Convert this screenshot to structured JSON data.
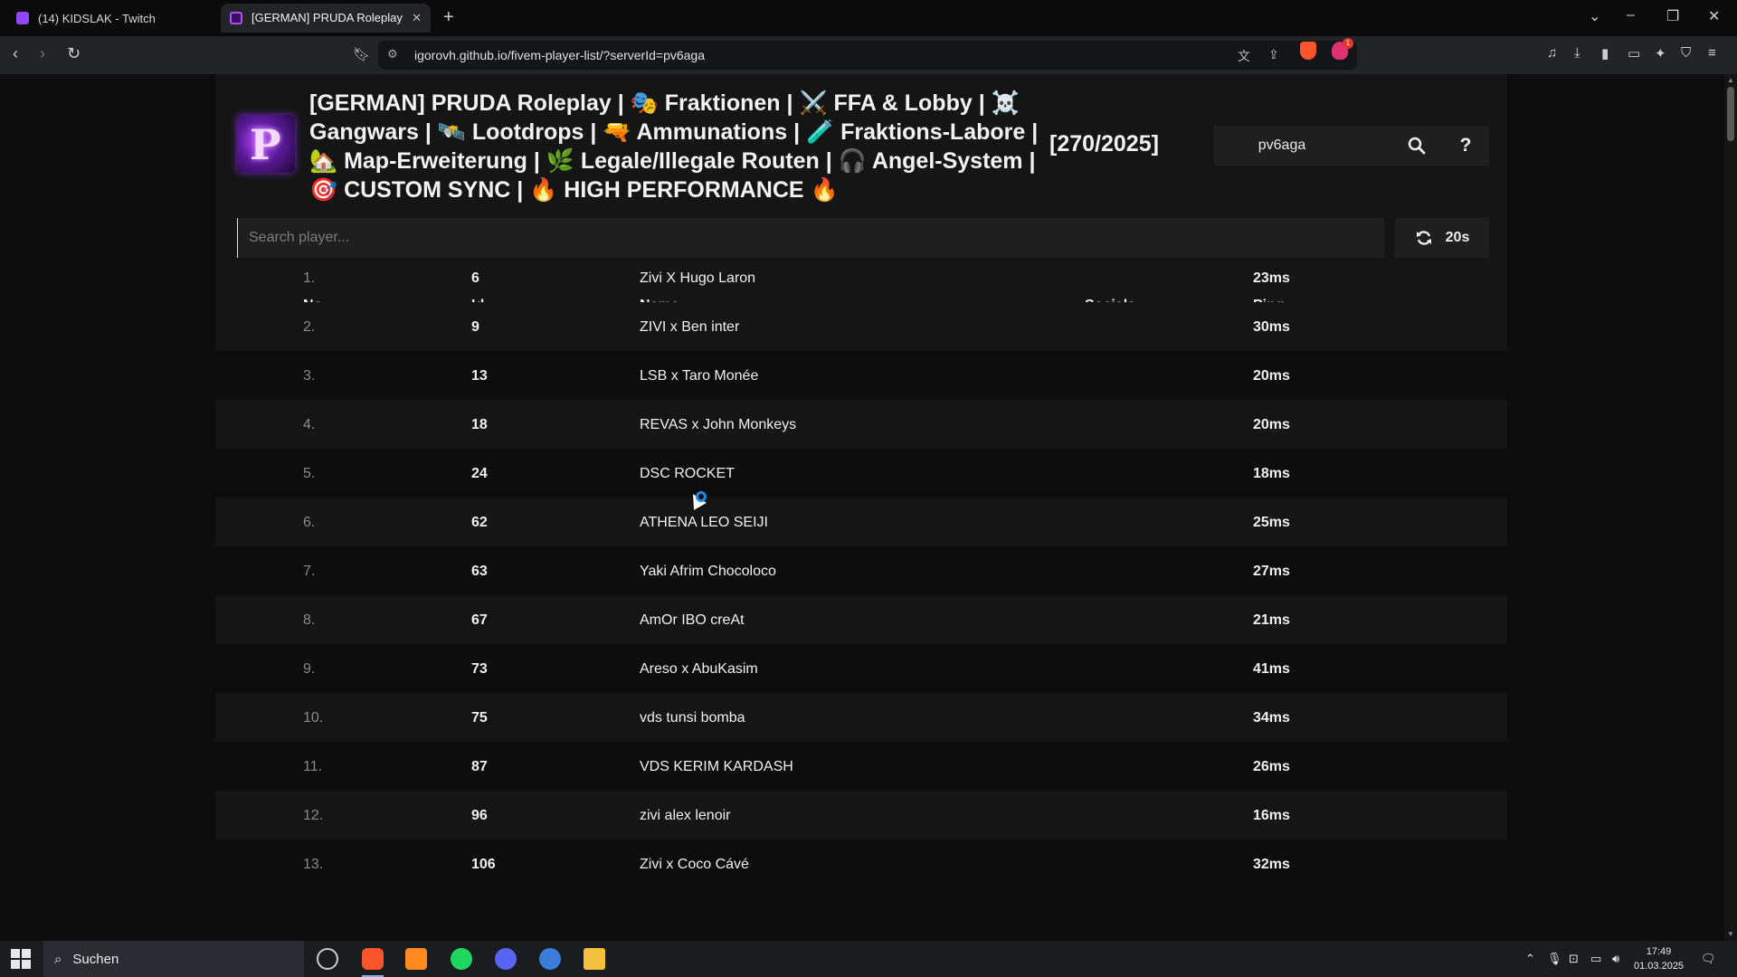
{
  "browser": {
    "tabs": [
      {
        "title": "(14) KIDSLAK - Twitch",
        "active": false
      },
      {
        "title": "[GERMAN] PRUDA Roleplay | 🎭",
        "active": true
      }
    ],
    "url": "igorovh.github.io/fivem-player-list/?serverId=pv6aga",
    "rewards_badge": "1",
    "colors": {
      "brave": "#fb542b",
      "accent": "#7ab3ff"
    }
  },
  "server": {
    "title": "[GERMAN] PRUDA Roleplay | 🎭 Fraktionen | ⚔️ FFA & Lobby | ☠️ Gangwars | 🛰️ Lootdrops | 🔫 Ammunations | 🧪 Fraktions-Labore | 🏡 Map-Erweiterung | 🌿 Legale/Illegale Routen | 🎧 Angel-System | 🎯 CUSTOM SYNC | 🔥 HIGH PERFORMANCE 🔥",
    "player_count": "[270/2025]",
    "server_id": "pv6aga",
    "logo_letter": "P",
    "help_label": "?"
  },
  "search": {
    "placeholder": "Search player..."
  },
  "refresh": {
    "interval": "20s"
  },
  "table": {
    "headers": {
      "no": "No.",
      "id": "Id",
      "name": "Name",
      "socials": "Socials",
      "ping": "Ping"
    },
    "rows": [
      {
        "no": "1.",
        "id": "6",
        "name": "Zivi X Hugo Laron",
        "ping": "23ms"
      },
      {
        "no": "2.",
        "id": "9",
        "name": "ZIVI x Ben inter",
        "ping": "30ms"
      },
      {
        "no": "3.",
        "id": "13",
        "name": "LSB x Taro Monée",
        "ping": "20ms"
      },
      {
        "no": "4.",
        "id": "18",
        "name": "REVAS x John Monkeys",
        "ping": "20ms"
      },
      {
        "no": "5.",
        "id": "24",
        "name": "DSC ROCKET",
        "ping": "18ms"
      },
      {
        "no": "6.",
        "id": "62",
        "name": "ATHENA LEO SEIJI",
        "ping": "25ms"
      },
      {
        "no": "7.",
        "id": "63",
        "name": "Yaki Afrim Chocoloco",
        "ping": "27ms"
      },
      {
        "no": "8.",
        "id": "67",
        "name": "AmOr IBO creAt",
        "ping": "21ms"
      },
      {
        "no": "9.",
        "id": "73",
        "name": "Areso x AbuKasim",
        "ping": "41ms"
      },
      {
        "no": "10.",
        "id": "75",
        "name": "vds tunsi bomba",
        "ping": "34ms"
      },
      {
        "no": "11.",
        "id": "87",
        "name": "VDS KERIM KARDASH",
        "ping": "26ms"
      },
      {
        "no": "12.",
        "id": "96",
        "name": "zivi alex lenoir",
        "ping": "16ms"
      },
      {
        "no": "13.",
        "id": "106",
        "name": "Zivi x Coco Cávé",
        "ping": "32ms"
      }
    ]
  },
  "taskbar": {
    "search_label": "Suchen",
    "time": "17:49",
    "date": "01.03.2025"
  }
}
